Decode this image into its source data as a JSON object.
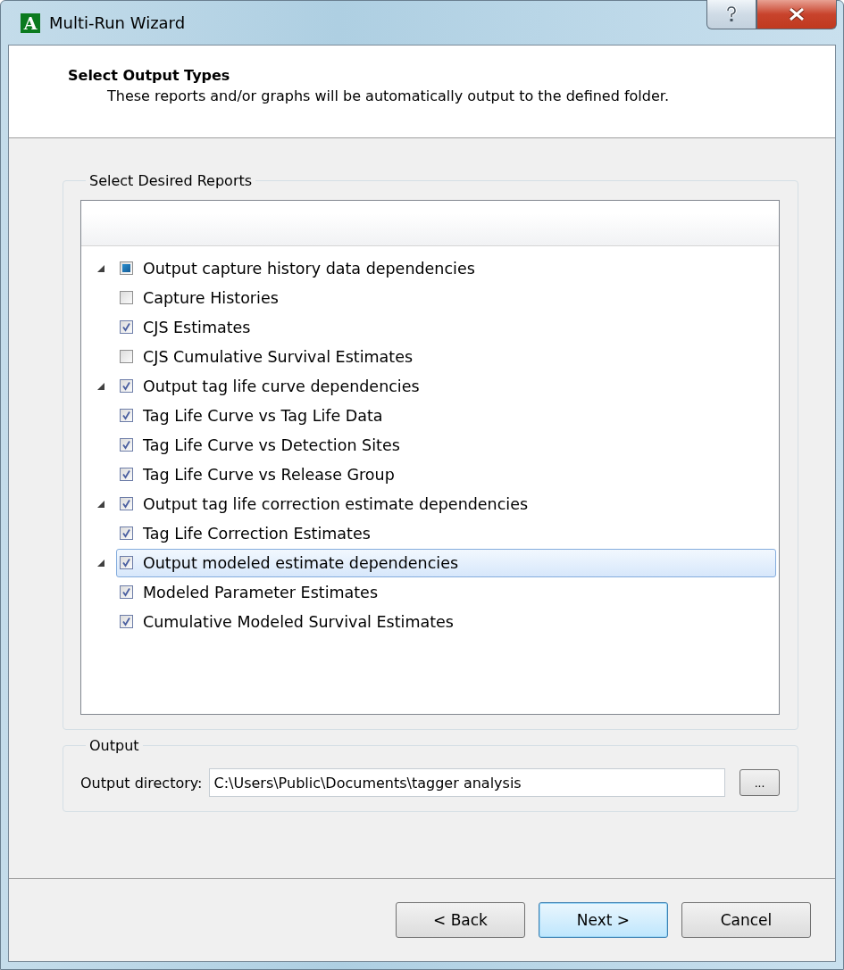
{
  "window": {
    "title": "Multi-Run Wizard",
    "icon_letter": "A"
  },
  "header": {
    "title": "Select Output Types",
    "subtitle": "These reports and/or graphs will be automatically output to the defined folder."
  },
  "reports": {
    "legend": "Select Desired Reports",
    "items": [
      {
        "label": "Output capture history data dependencies",
        "checked": false,
        "indeterminate": true,
        "expanded": true,
        "selected": false,
        "children": [
          {
            "label": "Capture Histories",
            "checked": false,
            "indeterminate": false,
            "selected": false
          },
          {
            "label": "CJS Estimates",
            "checked": true,
            "indeterminate": false,
            "selected": false
          },
          {
            "label": "CJS Cumulative Survival Estimates",
            "checked": false,
            "indeterminate": false,
            "selected": false
          }
        ]
      },
      {
        "label": "Output tag life curve dependencies",
        "checked": true,
        "indeterminate": false,
        "expanded": true,
        "selected": false,
        "children": [
          {
            "label": "Tag Life Curve vs Tag Life Data",
            "checked": true,
            "indeterminate": false,
            "selected": false
          },
          {
            "label": "Tag Life Curve vs Detection Sites",
            "checked": true,
            "indeterminate": false,
            "selected": false
          },
          {
            "label": "Tag Life Curve vs Release Group",
            "checked": true,
            "indeterminate": false,
            "selected": false
          }
        ]
      },
      {
        "label": "Output tag life correction estimate dependencies",
        "checked": true,
        "indeterminate": false,
        "expanded": true,
        "selected": false,
        "children": [
          {
            "label": "Tag Life Correction Estimates",
            "checked": true,
            "indeterminate": false,
            "selected": false
          }
        ]
      },
      {
        "label": "Output modeled estimate dependencies",
        "checked": true,
        "indeterminate": false,
        "expanded": true,
        "selected": true,
        "children": [
          {
            "label": "Modeled Parameter Estimates",
            "checked": true,
            "indeterminate": false,
            "selected": false
          },
          {
            "label": "Cumulative Modeled Survival Estimates",
            "checked": true,
            "indeterminate": false,
            "selected": false
          }
        ]
      }
    ]
  },
  "output": {
    "legend": "Output",
    "label": "Output directory:",
    "value": "C:\\Users\\Public\\Documents\\tagger analysis",
    "browse": "..."
  },
  "buttons": [
    {
      "label": "< Back",
      "default": false
    },
    {
      "label": "Next >",
      "default": true
    },
    {
      "label": "Cancel",
      "default": false
    }
  ]
}
